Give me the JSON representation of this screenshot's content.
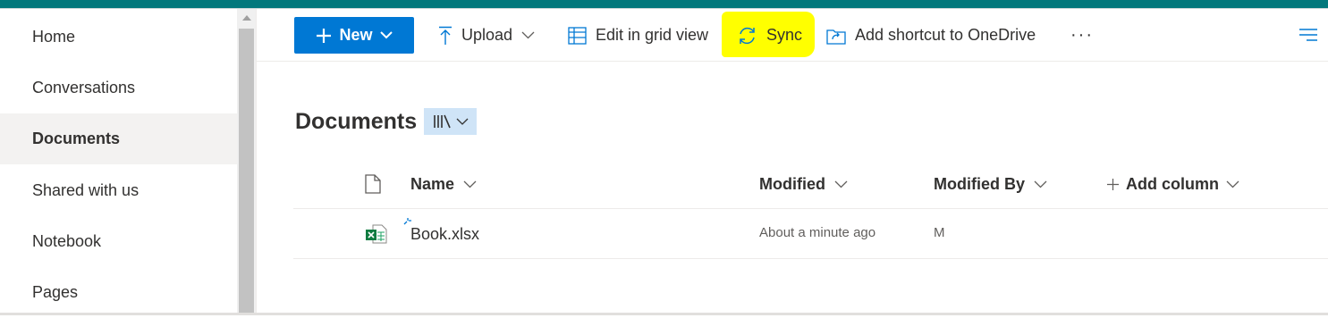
{
  "nav": {
    "items": [
      {
        "label": "Home"
      },
      {
        "label": "Conversations"
      },
      {
        "label": "Documents",
        "selected": true
      },
      {
        "label": "Shared with us"
      },
      {
        "label": "Notebook"
      },
      {
        "label": "Pages"
      }
    ]
  },
  "commandbar": {
    "new_label": "New",
    "upload_label": "Upload",
    "grid_label": "Edit in grid view",
    "sync_label": "Sync",
    "shortcut_label": "Add shortcut to OneDrive",
    "more_label": "···"
  },
  "library": {
    "title": "Documents"
  },
  "table": {
    "columns": {
      "name": "Name",
      "modified": "Modified",
      "modified_by": "Modified By",
      "add_column": "Add column"
    },
    "rows": [
      {
        "name": "Book.xlsx",
        "modified": "About a minute ago",
        "modified_by": "M"
      }
    ]
  },
  "icons": {
    "new": "plus-icon",
    "upload": "upload-icon",
    "grid": "grid-icon",
    "sync": "sync-icon",
    "shortcut": "shortcut-icon",
    "view": "view-options-icon",
    "file": "excel-file-icon"
  },
  "colors": {
    "accent": "#0078d4",
    "suite_bar": "#03787c",
    "highlight": "#ffff00",
    "selected_nav": "#f3f2f1"
  }
}
